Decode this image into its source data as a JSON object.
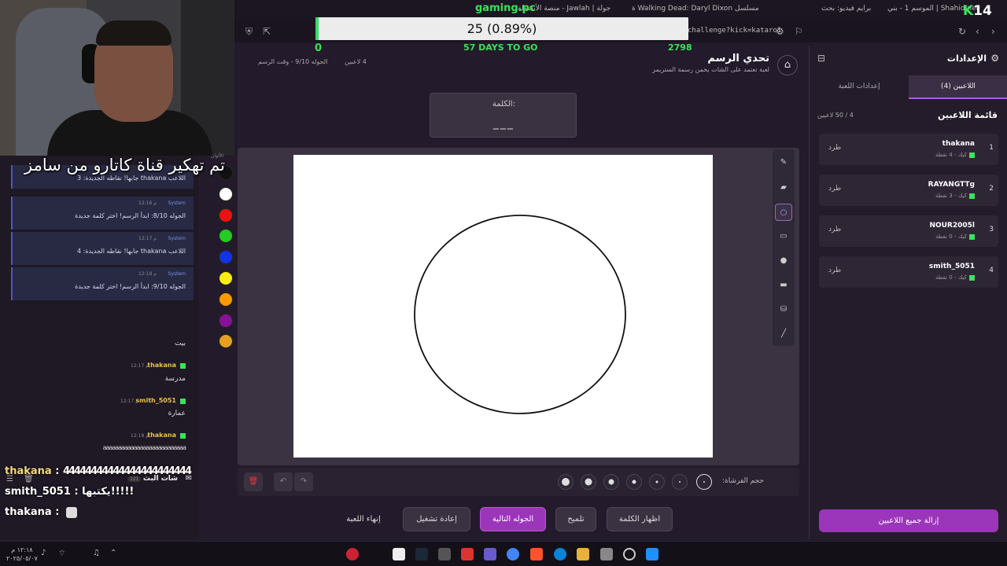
{
  "browser": {
    "tabs": [
      "برايم فيديو: بحث",
      "Shahid.net | الموسم 1 - بني",
      "مسلسل Walking Dead: Daryl Dixon ة",
      "جولة | Jawlah - منصة الأنشطة"
    ],
    "url": "challenge?kick=kataro1"
  },
  "overlay": {
    "brand": "gaming.pc",
    "progress_text": "25 (0.89%)",
    "progress_fraction": 0.0089,
    "goal_left": "0",
    "goal_mid": "57 DAYS TO GO",
    "goal_right": "2798",
    "kick_badge_k": "K",
    "kick_badge_num": "14",
    "banner": "تم تهكير قناة كاتارو من سامز"
  },
  "header": {
    "title": "تحدي الرسم",
    "subtitle": "لعبة تعتمد على الشات يخمن رسمة الستريمر",
    "players": "4 لاعبين",
    "round": "الجوله 9/10 - وقت الرسم"
  },
  "word": {
    "label": "الكلمة:",
    "value": "___"
  },
  "palette": {
    "label": "الألوان",
    "colors": [
      "#111111",
      "#ffffff",
      "#ee1111",
      "#22cc22",
      "#1133ee",
      "#ffee11",
      "#ff9900",
      "#881199",
      "#e6a020"
    ]
  },
  "brush": {
    "label": "حجم الفرشاة:"
  },
  "actions": {
    "show_word": "اظهار الكلمة",
    "hint": "تلميح",
    "next_round": "الجوله التالية",
    "restart": "إعادة تشغيل",
    "end_game": "إنهاء اللعبة"
  },
  "settings": {
    "title": "الإعدادات",
    "tab_players": "اللاعبين (4)",
    "tab_game": "إعدادات اللعبة",
    "list_title": "قائمة اللاعبين",
    "count": "4 / 50 لاعبين",
    "kick_label": "طرد",
    "players": [
      {
        "rank": "1",
        "name": "thakana",
        "meta": "كيك - 4 نقطة"
      },
      {
        "rank": "2",
        "name": "RAYANGTTg",
        "meta": "كيك - 3 نقطة"
      },
      {
        "rank": "3",
        "name": "NOUR2005l",
        "meta": "كيك - 0 نقطة"
      },
      {
        "rank": "4",
        "name": "smith_5051",
        "meta": "كيك - 0 نقطة"
      }
    ],
    "remove_all": "إزالة جميع اللاعبين"
  },
  "chat": {
    "system": [
      {
        "who": "System",
        "time": "12:16 م",
        "msg": "الجوله 8/10: ابدأ الرسم! اختر كلمة جديدة"
      },
      {
        "who": "System",
        "time": "12:17 م",
        "msg": "اللاعب thakana جابها! نقاطه الجديدة: 4"
      },
      {
        "who": "System",
        "time": "12:18 م",
        "msg": "الجوله 9/10: ابدأ الرسم! اختر كلمة جديدة"
      }
    ],
    "partial_sys": "اللاعب thakana جابها! نقاطه الجديدة: 3",
    "stream_title": "شات البث",
    "stream_count": "121",
    "first_msg": "بيت",
    "messages": [
      {
        "user": "thakana",
        "time": "12:17 م",
        "text": "مدرسة"
      },
      {
        "user": "smith_5051",
        "time": "12:17 م",
        "text": "عمارة"
      },
      {
        "user": "thakana",
        "time": "12:18 م",
        "text": "aaaaaaaaaaaaaaaaaaaaaaaaaaa"
      }
    ]
  },
  "overlay_chat": [
    {
      "user": "thakana",
      "text": "44444444444444444444444"
    },
    {
      "user": "smith_5051",
      "text": "يكتبها!!!!!"
    },
    {
      "user": "thakana",
      "text": ""
    }
  ],
  "taskbar": {
    "time": "١٢:١٨ م",
    "date": "٢٠٢٥/٠٥/٠٧"
  }
}
